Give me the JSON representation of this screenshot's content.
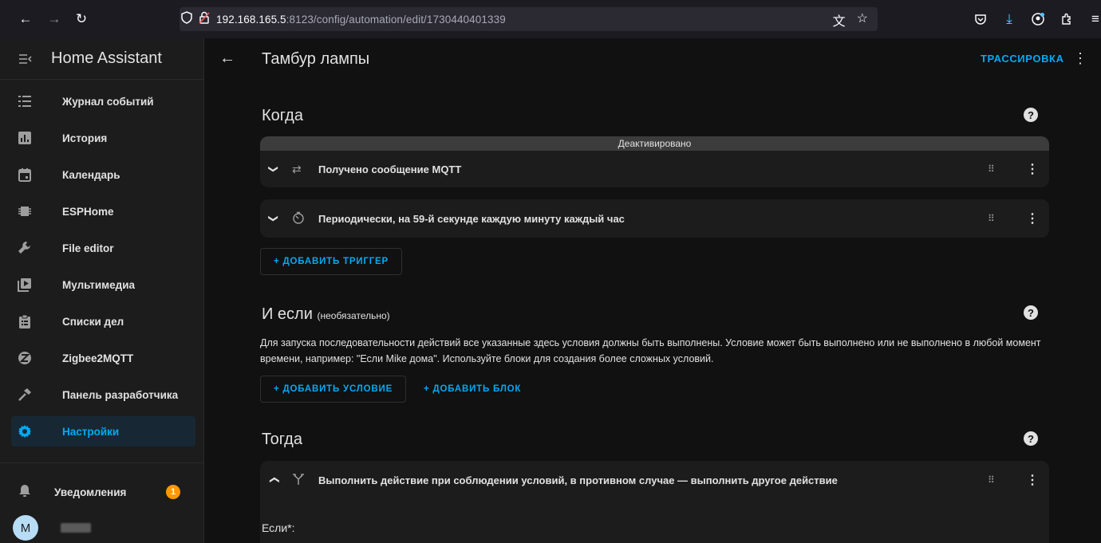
{
  "browser": {
    "url_host": "192.168.165.5",
    "url_rest": ":8123/config/automation/edit/1730440401339"
  },
  "sidebar": {
    "title": "Home Assistant",
    "items": [
      {
        "label": "Журнал событий",
        "icon": "list-icon"
      },
      {
        "label": "История",
        "icon": "chart-box-icon"
      },
      {
        "label": "Календарь",
        "icon": "calendar-icon"
      },
      {
        "label": "ESPHome",
        "icon": "chip-icon"
      },
      {
        "label": "File editor",
        "icon": "wrench-icon"
      },
      {
        "label": "Мультимедиа",
        "icon": "play-box-icon"
      },
      {
        "label": "Списки дел",
        "icon": "clipboard-list-icon"
      },
      {
        "label": "Zigbee2MQTT",
        "icon": "zigbee-icon"
      },
      {
        "label": "Панель разработчика",
        "icon": "hammer-icon"
      },
      {
        "label": "Настройки",
        "icon": "cog-icon",
        "active": true
      }
    ],
    "notifications": {
      "label": "Уведомления",
      "count": "1"
    },
    "user_initial": "M"
  },
  "header": {
    "title": "Тамбур лампы",
    "trace_label": "ТРАССИРОВКА"
  },
  "when": {
    "title": "Когда",
    "disabled_banner": "Деактивировано",
    "triggers": [
      {
        "label": "Получено сообщение MQTT",
        "icon": "swap-icon"
      },
      {
        "label": "Периодически, на 59-й секунде каждую минуту каждый час",
        "icon": "timer-icon"
      }
    ],
    "add_trigger": "+ ДОБАВИТЬ ТРИГГЕР"
  },
  "conditions": {
    "title": "И если",
    "optional": "(необязательно)",
    "description": "Для запуска последовательности действий все указанные здесь условия должны быть выполнены. Условие может быть выполнено или не выполнено в любой момент времени, например: \"Если Mike дома\". Используйте блоки для создания более сложных условий.",
    "add_condition": "+ ДОБАВИТЬ УСЛОВИЕ",
    "add_block": "+ ДОБАВИТЬ БЛОК"
  },
  "actions": {
    "title": "Тогда",
    "items": [
      {
        "label": "Выполнить действие при соблюдении условий, в противном случае — выполнить другое действие",
        "icon": "source-branch-icon"
      }
    ],
    "if_label": "Если*:"
  },
  "colors": {
    "accent": "#03a9f4",
    "badge": "#ff9800",
    "background": "#111111",
    "card": "#1c1c1c"
  }
}
